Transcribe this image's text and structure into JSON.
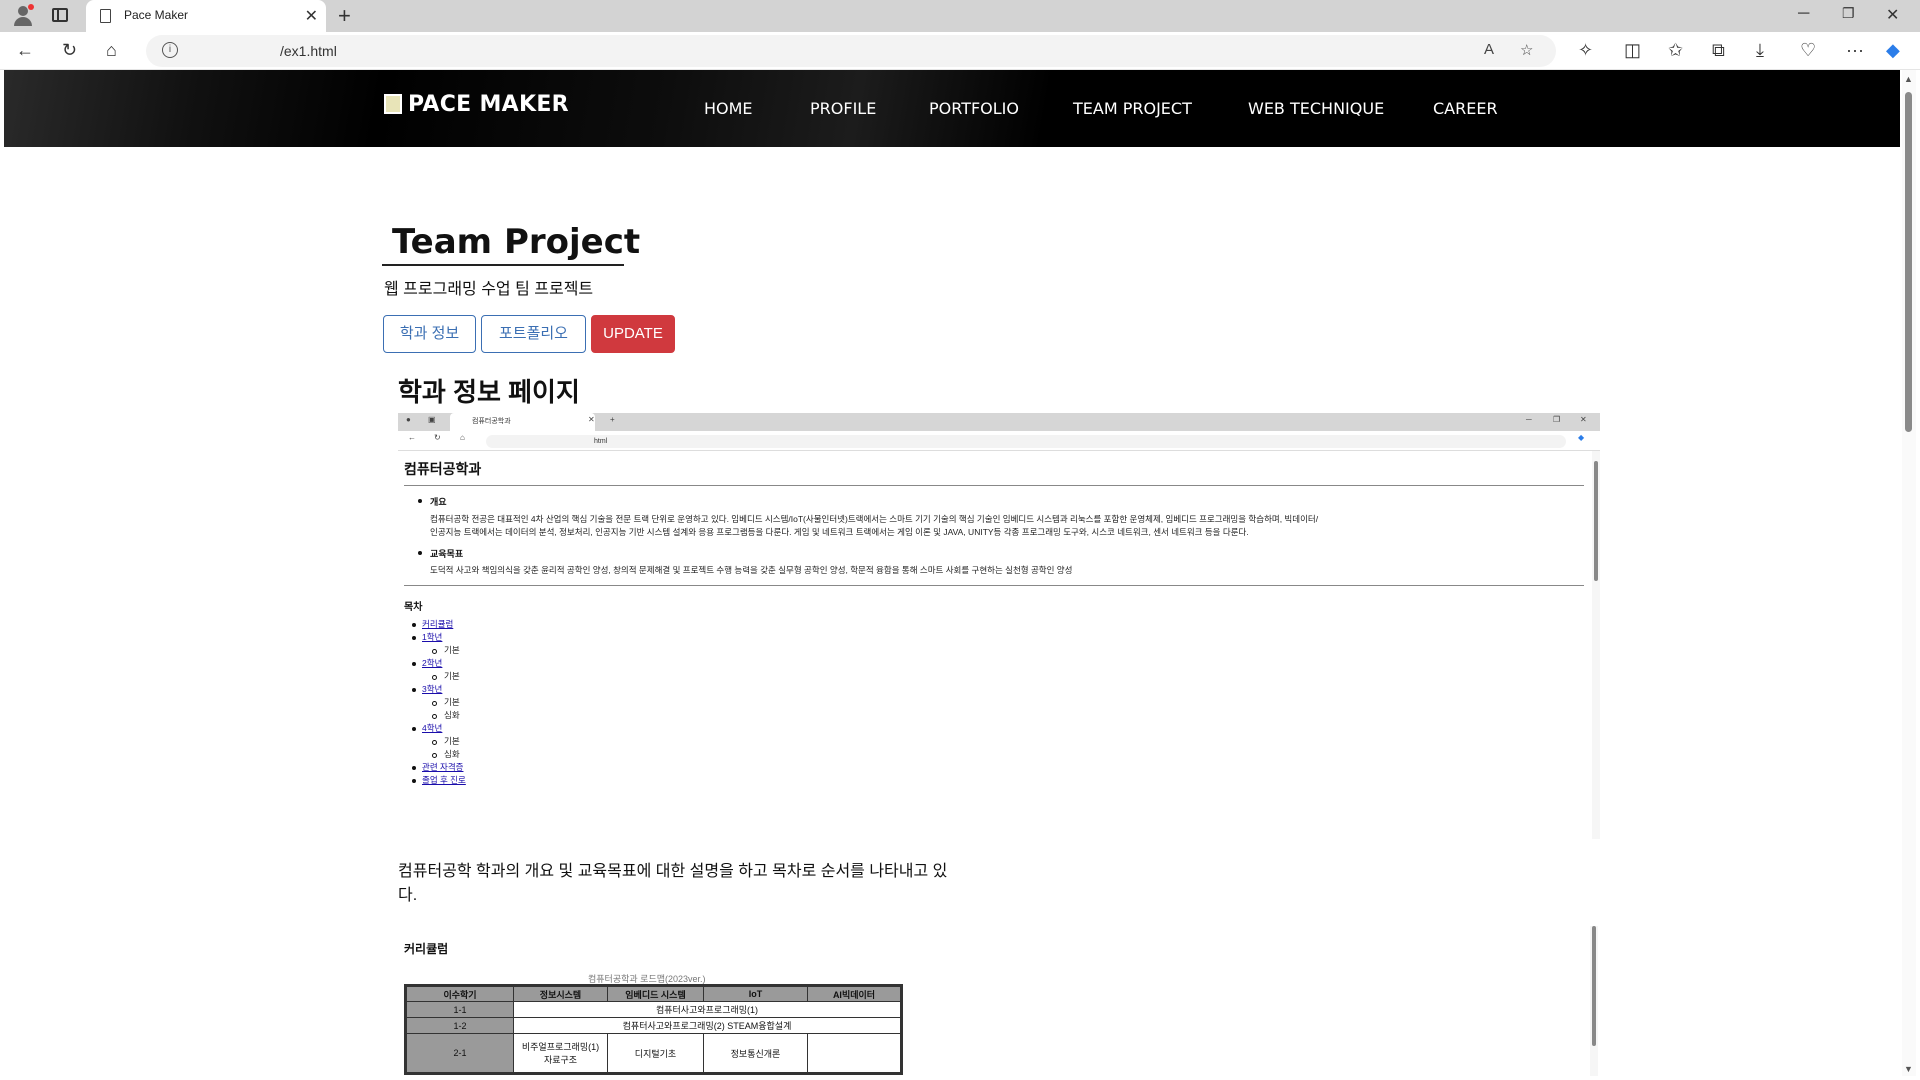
{
  "browser": {
    "tab_title": "Pace Maker",
    "url": "/ex1.html",
    "window_controls": [
      "minimize-icon",
      "restore-icon",
      "close-icon"
    ]
  },
  "site": {
    "brand": "PACE MAKER",
    "nav": [
      "HOME",
      "PROFILE",
      "PORTFOLIO",
      "TEAM PROJECT",
      "WEB TECHNIQUE",
      "CAREER"
    ]
  },
  "page": {
    "title": "Team Project",
    "subtitle": "웹 프로그래밍 수업 팀 프로젝트",
    "buttons": [
      "학과 정보",
      "포트폴리오",
      "UPDATE"
    ],
    "section_title": "학과 정보 페이지",
    "description": "컴퓨터공학 학과의 개요 및 교육목표에 대한 설명을 하고 목차로 순서를 나타내고 있다."
  },
  "screenshot1": {
    "tab_title": "컴퓨터공학과",
    "url": "html",
    "heading": "컴퓨터공학과",
    "overview_label": "개요",
    "overview_text_1": "컴퓨터공학 전공은 대표적인 4차 산업의 핵심 기술을 전문 트랙 단위로 운영하고 있다. 임베디드 시스템/IoT(사물인터넷)트랙에서는 스마트 기기 기술의 핵심 기술인 임베디드 시스템과 리눅스를 포함한 운영체제, 임베디드 프로그래밍을 학습하며, 빅데이터/",
    "overview_text_2": "인공지능 트랙에서는 데이터의 분석, 정보처리, 인공지능 기반 시스템 설계와 응용 프로그램등을 다룬다. 게임 및 네트워크 트랙에서는 게임 이론 및 JAVA, UNITY등 각종 프로그래밍 도구와, 시스코 네트워크, 센서 네트워크 등을 다룬다.",
    "goal_label": "교육목표",
    "goal_text": "도덕적 사고와 책임의식을 갖춘 윤리적 공학인 양성, 창의적 문제해결 및 프로젝트 수행 능력을 갖춘 실무형 공학인 양성, 학문적 융합을 통해 스마트 사회를 구현하는 실천형 공학인 양성",
    "toc_title": "목차",
    "toc": {
      "curriculum": "커리큘럼",
      "y1": "1학년",
      "y1_sub": "기본",
      "y2": "2학년",
      "y2_sub": "기본",
      "y3": "3학년",
      "y3_sub1": "기본",
      "y3_sub2": "심화",
      "y4": "4학년",
      "y4_sub1": "기본",
      "y4_sub2": "심화",
      "certs": "관련 자격증",
      "career": "졸업 후 진로"
    }
  },
  "screenshot2": {
    "heading": "커리큘럼",
    "caption": "컴퓨터공학과 로드맵(2023ver.)",
    "headers": [
      "이수학기",
      "정보시스템",
      "임베디드 시스템",
      "IoT",
      "AI빅데이터"
    ],
    "row1_term": "1-1",
    "row1_course": "컴퓨터사고와프로그래밍(1)",
    "row2_term": "1-2",
    "row2_course": "컴퓨터사고와프로그래밍(2) STEAM융합설계",
    "row3_term": "2-1",
    "row3_c1a": "비주얼프로그래밍(1)",
    "row3_c1b": "자료구조",
    "row3_c2": "디지털기초",
    "row3_c3": "정보통신개론"
  }
}
